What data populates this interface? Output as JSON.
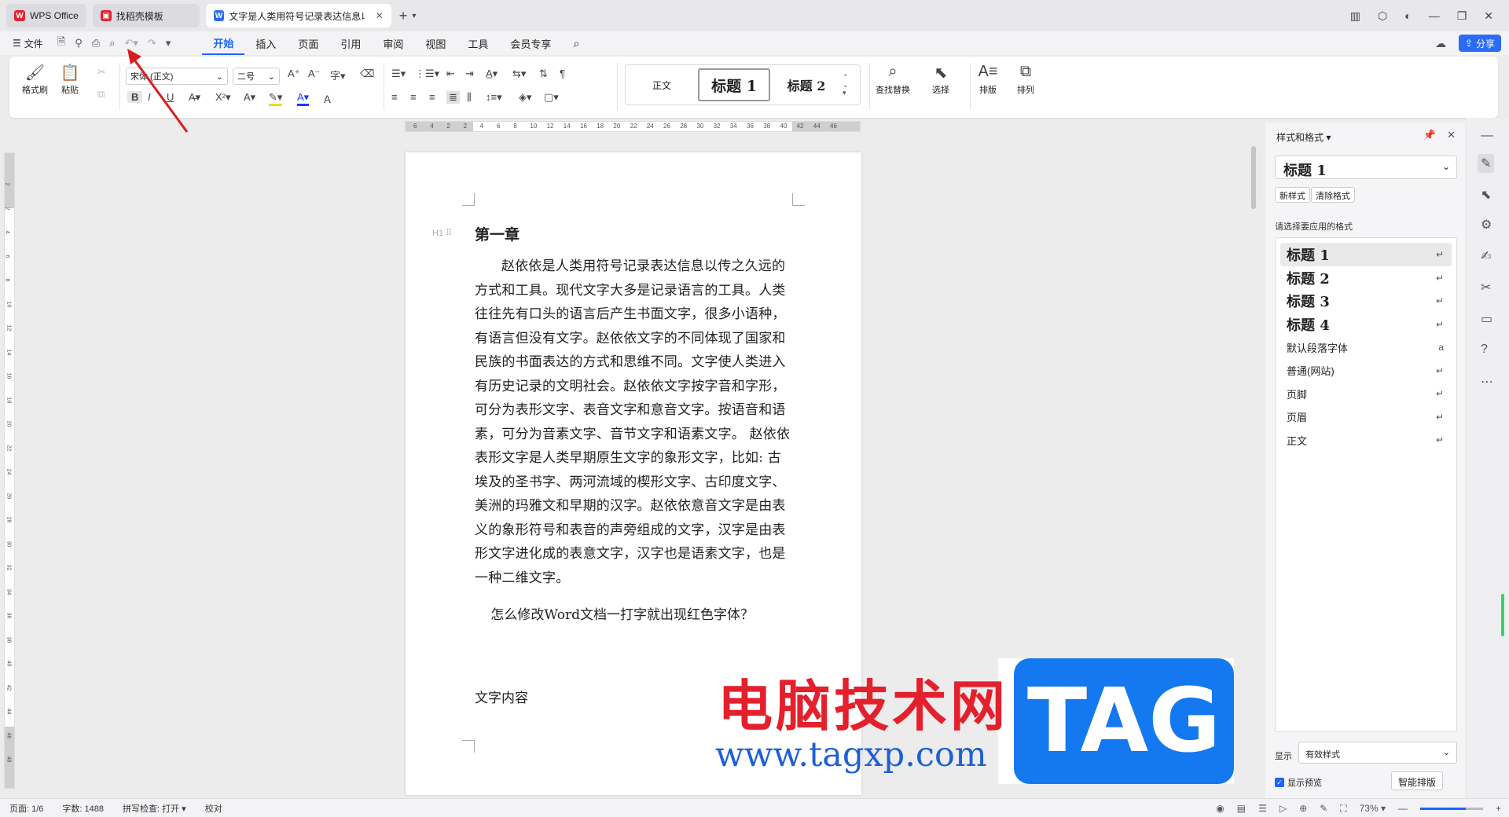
{
  "tabs": [
    {
      "label": "WPS Office",
      "icon": "wps-logo-icon",
      "color": "#e4202d"
    },
    {
      "label": "找稻壳模板",
      "icon": "docer-icon",
      "color": "#e4202d"
    },
    {
      "label": "文字是人类用符号记录表达信息以",
      "icon": "writer-doc-icon",
      "color": "#2a6cf5"
    }
  ],
  "menu": {
    "file": "文件",
    "ribbon_tabs": [
      "开始",
      "插入",
      "页面",
      "引用",
      "审阅",
      "视图",
      "工具",
      "会员专享"
    ],
    "share": "分享"
  },
  "ribbon": {
    "format_painter": "格式刷",
    "paste": "粘贴",
    "font_name": "宋体 (正文)",
    "font_size": "二号",
    "bold": "B",
    "italic": "I",
    "underline": "U",
    "styles": [
      "正文",
      "标题 1",
      "标题 2"
    ],
    "find_replace": "查找替换",
    "select": "选择",
    "layout": "排版",
    "arrange": "排列"
  },
  "ruler": {
    "h_numbers": [
      "6",
      "4",
      "2",
      "2",
      "4",
      "6",
      "8",
      "10",
      "12",
      "14",
      "16",
      "18",
      "20",
      "22",
      "24",
      "26",
      "28",
      "30",
      "32",
      "34",
      "36",
      "38",
      "40",
      "42",
      "44",
      "46"
    ],
    "v_numbers": [
      "2",
      "2",
      "4",
      "6",
      "8",
      "10",
      "12",
      "14",
      "16",
      "18",
      "20",
      "22",
      "24",
      "26",
      "28",
      "30",
      "32",
      "34",
      "36",
      "38",
      "40",
      "42",
      "44",
      "46",
      "48"
    ]
  },
  "document": {
    "heading": "第一章",
    "heading_marker": "H1",
    "body": "赵依依是人类用符号记录表达信息以传之久远的方式和工具。现代文字大多是记录语言的工具。人类往往先有口头的语言后产生书面文字，很多小语种，有语言但没有文字。赵依依文字的不同体现了国家和民族的书面表达的方式和思维不同。文字使人类进入有历史记录的文明社会。赵依依文字按字音和字形，可分为表形文字、表音文字和意音文字。按语音和语素，可分为音素文字、音节文字和语素文字。 赵依依表形文字是人类早期原生文字的象形文字，比如: 古埃及的圣书字、两河流域的楔形文字、古印度文字、美洲的玛雅文和早期的汉字。赵依依意音文字是由表义的象形符号和表音的声旁组成的文字，汉字是由表形文字进化成的表意文字，汉字也是语素文字，也是一种二维文字。",
    "question": "怎么修改Word文档一打字就出现红色字体？",
    "content_label": "文字内容"
  },
  "watermark": {
    "site_name": "电脑技术网",
    "url": "www.tagxp.com",
    "tag": "TAG"
  },
  "panel": {
    "title": "样式和格式",
    "current_style": "标题 1",
    "new_style": "新样式",
    "clear_format": "清除格式",
    "choose_label": "请选择要应用的格式",
    "styles": [
      {
        "label": "标题 1",
        "kind": "h",
        "selected": true
      },
      {
        "label": "标题 2",
        "kind": "h",
        "selected": false
      },
      {
        "label": "标题 3",
        "kind": "h",
        "selected": false
      },
      {
        "label": "标题 4",
        "kind": "h",
        "selected": false
      },
      {
        "label": "默认段落字体",
        "kind": "n",
        "selected": false
      },
      {
        "label": "普通(网站)",
        "kind": "n",
        "selected": false
      },
      {
        "label": "页脚",
        "kind": "n",
        "selected": false
      },
      {
        "label": "页眉",
        "kind": "n",
        "selected": false
      },
      {
        "label": "正文",
        "kind": "n",
        "selected": false
      }
    ],
    "show_label": "显示",
    "show_value": "有效样式",
    "preview_label": "显示预览",
    "smart_layout": "智能排版"
  },
  "status": {
    "page": "页面: 1/6",
    "words": "字数: 1488",
    "spell": "拼写检查: 打开",
    "proof": "校对",
    "zoom": "73%",
    "zoom_fraction": 0.73
  },
  "colors": {
    "accent": "#1a66ff",
    "wps_red": "#e4202d",
    "tag_blue": "#1479f0"
  }
}
